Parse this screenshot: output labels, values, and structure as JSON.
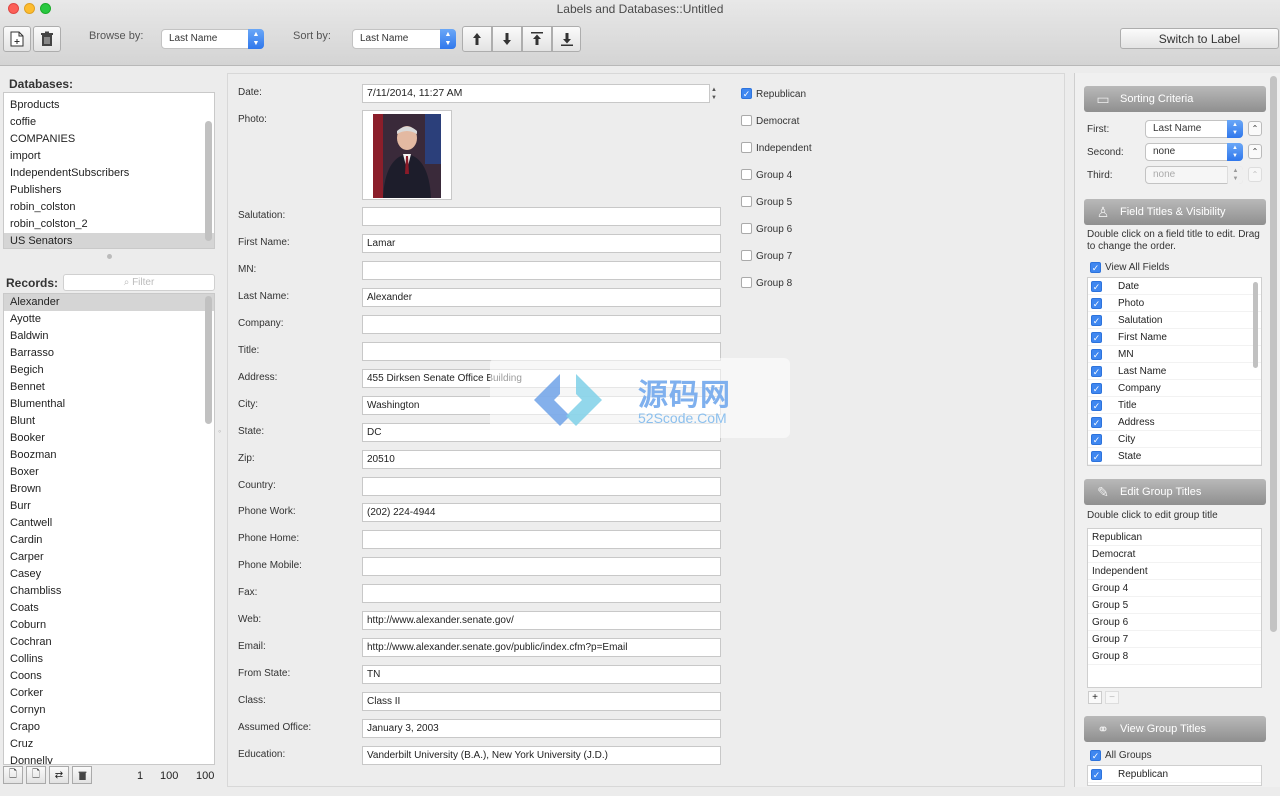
{
  "window": {
    "title": "Labels and Databases::Untitled"
  },
  "toolbar": {
    "browse_label": "Browse by:",
    "browse_value": "Last Name",
    "sort_label": "Sort by:",
    "sort_value": "Last Name",
    "switch_label": "Switch to Label"
  },
  "databases": {
    "label": "Databases:",
    "items": [
      "Bproducts",
      "coffie",
      "COMPANIES",
      "import",
      "IndependentSubscribers",
      "Publishers",
      "robin_colston",
      "robin_colston_2",
      "US Senators"
    ],
    "selected": "US Senators"
  },
  "records": {
    "label": "Records:",
    "filter_placeholder": "Filter",
    "items": [
      "Alexander",
      "Ayotte",
      "Baldwin",
      "Barrasso",
      "Begich",
      "Bennet",
      "Blumenthal",
      "Blunt",
      "Booker",
      "Boozman",
      "Boxer",
      "Brown",
      "Burr",
      "Cantwell",
      "Cardin",
      "Carper",
      "Casey",
      "Chambliss",
      "Coats",
      "Coburn",
      "Cochran",
      "Collins",
      "Coons",
      "Corker",
      "Cornyn",
      "Crapo",
      "Cruz",
      "Donnelly"
    ],
    "selected": "Alexander",
    "counts": [
      "1",
      "100",
      "100"
    ]
  },
  "form": {
    "date_label": "Date:",
    "date_value": "7/11/2014, 11:27 AM",
    "photo_label": "Photo:",
    "fields": [
      {
        "label": "Salutation:",
        "value": ""
      },
      {
        "label": "First Name:",
        "value": "Lamar"
      },
      {
        "label": "MN:",
        "value": ""
      },
      {
        "label": "Last Name:",
        "value": "Alexander"
      },
      {
        "label": "Company:",
        "value": ""
      },
      {
        "label": "Title:",
        "value": ""
      },
      {
        "label": "Address:",
        "value": "455 Dirksen Senate Office Building"
      },
      {
        "label": "City:",
        "value": "Washington"
      },
      {
        "label": "State:",
        "value": "DC"
      },
      {
        "label": "Zip:",
        "value": "20510"
      },
      {
        "label": "Country:",
        "value": ""
      },
      {
        "label": "Phone Work:",
        "value": "(202) 224-4944"
      },
      {
        "label": "Phone Home:",
        "value": ""
      },
      {
        "label": "Phone Mobile:",
        "value": ""
      },
      {
        "label": "Fax:",
        "value": ""
      },
      {
        "label": "Web:",
        "value": "http://www.alexander.senate.gov/"
      },
      {
        "label": "Email:",
        "value": "http://www.alexander.senate.gov/public/index.cfm?p=Email"
      },
      {
        "label": "From State:",
        "value": "TN"
      },
      {
        "label": "Class:",
        "value": "Class II"
      },
      {
        "label": "Assumed Office:",
        "value": "January 3, 2003"
      },
      {
        "label": "Education:",
        "value": "Vanderbilt University (B.A.), New York University (J.D.)"
      }
    ]
  },
  "groups": [
    {
      "label": "Republican",
      "checked": true
    },
    {
      "label": "Democrat",
      "checked": false
    },
    {
      "label": "Independent",
      "checked": false
    },
    {
      "label": "Group 4",
      "checked": false
    },
    {
      "label": "Group 5",
      "checked": false
    },
    {
      "label": "Group 6",
      "checked": false
    },
    {
      "label": "Group 7",
      "checked": false
    },
    {
      "label": "Group 8",
      "checked": false
    }
  ],
  "sorting": {
    "header": "Sorting Criteria",
    "first_label": "First:",
    "first_value": "Last Name",
    "second_label": "Second:",
    "second_value": "none",
    "third_label": "Third:",
    "third_value": "none"
  },
  "field_titles": {
    "header": "Field Titles & Visibility",
    "help": "Double click on a field title to edit. Drag to change the order.",
    "view_all": "View All Fields",
    "items": [
      "Date",
      "Photo",
      "Salutation",
      "First Name",
      "MN",
      "Last Name",
      "Company",
      "Title",
      "Address",
      "City",
      "State"
    ]
  },
  "edit_groups": {
    "header": "Edit Group Titles",
    "help": "Double click to edit group title",
    "items": [
      "Republican",
      "Democrat",
      "Independent",
      "Group 4",
      "Group 5",
      "Group 6",
      "Group 7",
      "Group 8"
    ]
  },
  "view_groups": {
    "header": "View Group Titles",
    "all_label": "All Groups",
    "items": [
      "Republican"
    ]
  },
  "watermark": {
    "title": "源码网",
    "subtitle": "52Scode.CoM"
  },
  "colors": {
    "accent": "#3f87f0",
    "header_gray": "#9a9a9a"
  }
}
